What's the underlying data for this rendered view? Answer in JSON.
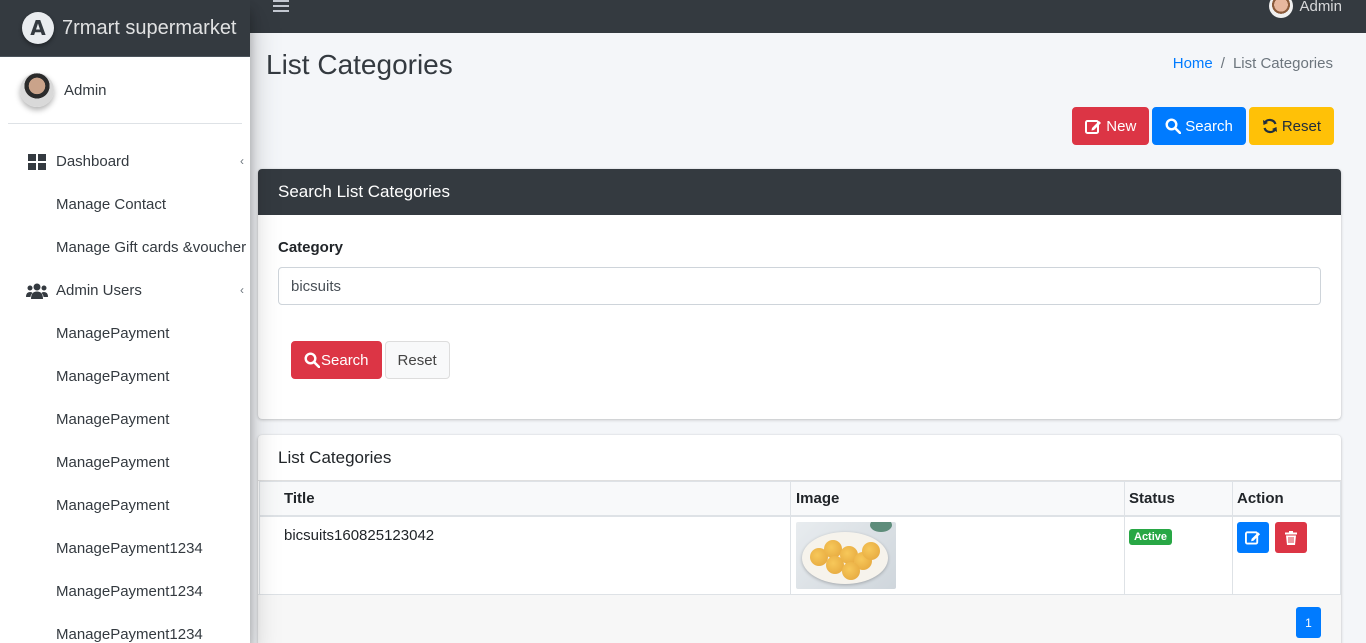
{
  "brand": {
    "name": "7rmart supermarket"
  },
  "user": {
    "name": "Admin"
  },
  "sidebar": {
    "items": [
      {
        "label": "Dashboard"
      },
      {
        "label": "Manage Contact"
      },
      {
        "label": "Manage Gift cards &voucher"
      },
      {
        "label": "Admin Users"
      },
      {
        "label": "ManagePayment"
      },
      {
        "label": "ManagePayment"
      },
      {
        "label": "ManagePayment"
      },
      {
        "label": "ManagePayment"
      },
      {
        "label": "ManagePayment"
      },
      {
        "label": "ManagePayment1234"
      },
      {
        "label": "ManagePayment1234"
      },
      {
        "label": "ManagePayment1234"
      }
    ]
  },
  "topbar": {
    "user_name": "Admin"
  },
  "page": {
    "title": "List Categories",
    "breadcrumb": {
      "home": "Home",
      "separator": "/",
      "current": "List Categories"
    }
  },
  "actions": {
    "new_label": "New",
    "search_label": "Search",
    "reset_label": "Reset"
  },
  "search_panel": {
    "title": "Search List Categories",
    "field_label": "Category",
    "field_value": "bicsuits",
    "search_button": "Search",
    "reset_button": "Reset"
  },
  "list": {
    "title": "List Categories",
    "columns": [
      "Title",
      "Image",
      "Status",
      "Action"
    ],
    "rows": [
      {
        "title": "bicsuits160825123042",
        "status": "Active"
      }
    ],
    "pagination": {
      "current": "1"
    }
  },
  "colors": {
    "danger": "#dc3545",
    "primary": "#007bff",
    "warning": "#ffc107",
    "dark": "#343a40",
    "success": "#28a745"
  }
}
